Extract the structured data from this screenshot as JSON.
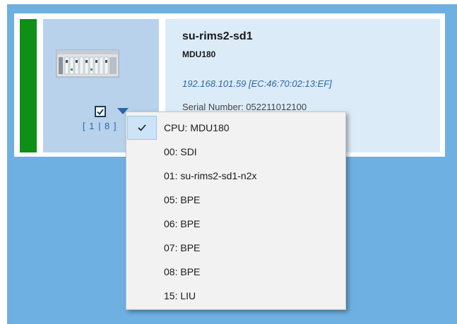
{
  "device": {
    "name": "su-rims2-sd1",
    "model": "MDU180",
    "address": "192.168.101.59 [EC:46:70:02:13:EF]",
    "serial": "Serial Number: 052211012100",
    "slots": "[ 1 | 8 ]",
    "status_color": "#0e8f16"
  },
  "icons": {
    "device": "device-chassis-icon",
    "checkbox": "checkbox-checked-icon",
    "dropdown": "triangle-down-icon",
    "checkmark": "checkmark-icon"
  },
  "menu": {
    "items": [
      {
        "label": "CPU: MDU180",
        "checked": true
      },
      {
        "label": "00: SDI",
        "checked": false
      },
      {
        "label": "01: su-rims2-sd1-n2x",
        "checked": false
      },
      {
        "label": "05: BPE",
        "checked": false
      },
      {
        "label": "06: BPE",
        "checked": false
      },
      {
        "label": "07: BPE",
        "checked": false
      },
      {
        "label": "08: BPE",
        "checked": false
      },
      {
        "label": "15: LIU",
        "checked": false
      }
    ]
  }
}
